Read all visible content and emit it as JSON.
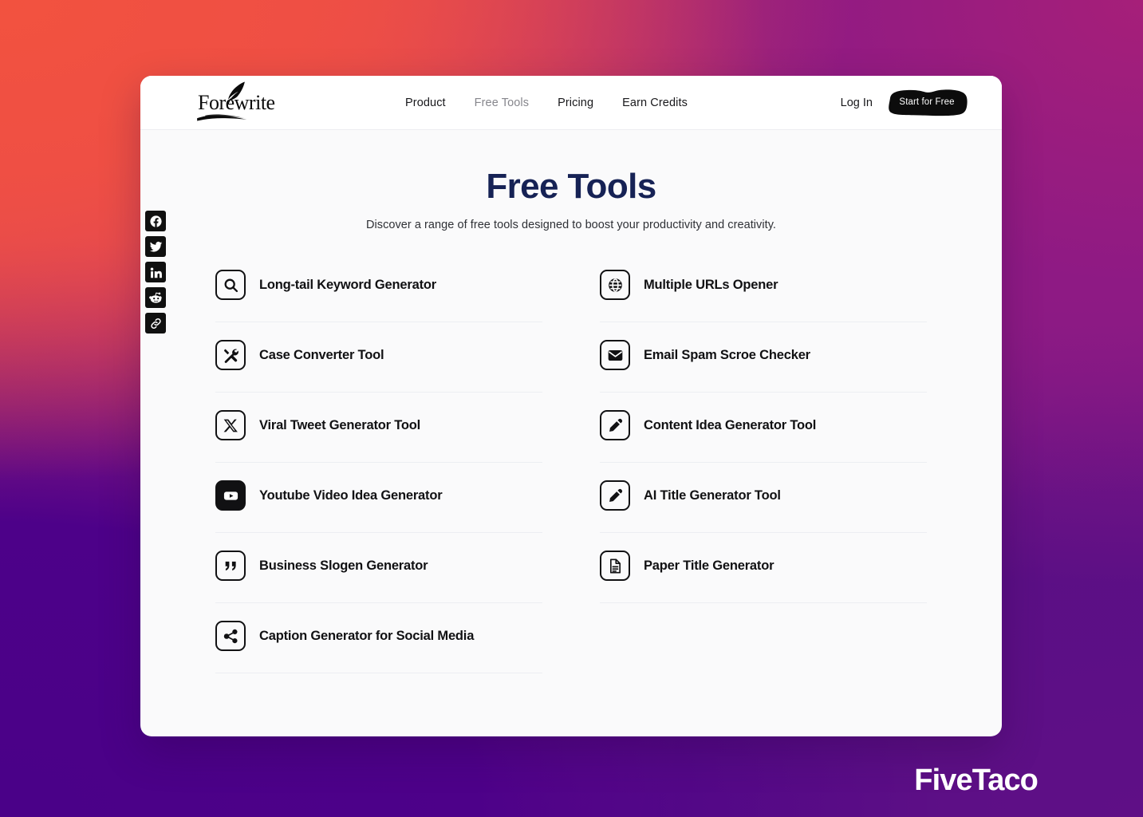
{
  "brand": {
    "name": "Forewrite",
    "quill_icon": "quill-icon"
  },
  "header": {
    "nav": [
      {
        "label": "Product",
        "active": false
      },
      {
        "label": "Free Tools",
        "active": true
      },
      {
        "label": "Pricing",
        "active": false
      },
      {
        "label": "Earn Credits",
        "active": false
      }
    ],
    "login_label": "Log In",
    "cta_label": "Start for Free"
  },
  "share_rail": {
    "items": [
      {
        "name": "facebook-share-icon",
        "label": "Facebook"
      },
      {
        "name": "twitter-share-icon",
        "label": "Twitter"
      },
      {
        "name": "linkedin-share-icon",
        "label": "LinkedIn"
      },
      {
        "name": "reddit-share-icon",
        "label": "Reddit"
      },
      {
        "name": "copy-link-icon",
        "label": "Copy Link"
      }
    ]
  },
  "main": {
    "title": "Free Tools",
    "subtitle": "Discover a range of free tools designed to boost your productivity and creativity.",
    "tools_left": [
      {
        "label": "Long-tail Keyword Generator",
        "icon": "search-icon"
      },
      {
        "label": "Case Converter Tool",
        "icon": "tools-icon"
      },
      {
        "label": "Viral Tweet Generator Tool",
        "icon": "x-twitter-icon"
      },
      {
        "label": "Youtube Video Idea Generator",
        "icon": "youtube-icon"
      },
      {
        "label": "Business Slogen Generator",
        "icon": "quote-icon"
      },
      {
        "label": "Caption Generator for Social Media",
        "icon": "share-nodes-icon"
      }
    ],
    "tools_right": [
      {
        "label": "Multiple URLs Opener",
        "icon": "globe-icon"
      },
      {
        "label": "Email Spam Scroe Checker",
        "icon": "envelope-icon"
      },
      {
        "label": "Content Idea Generator Tool",
        "icon": "pencil-icon"
      },
      {
        "label": "AI Title Generator Tool",
        "icon": "pencil-icon"
      },
      {
        "label": "Paper Title Generator",
        "icon": "document-icon"
      }
    ]
  },
  "watermark": {
    "text": "FiveTaco"
  },
  "colors": {
    "title": "#162255",
    "text": "#111113",
    "muted": "#86868c",
    "cta_bg": "#0c0c0c",
    "divider": "#eceef2",
    "card_bg": "#fafafb",
    "header_bg": "#ffffff",
    "bg_coral": "#ee5542",
    "bg_magenta": "#a61f79",
    "bg_purple": "#4a0188"
  }
}
